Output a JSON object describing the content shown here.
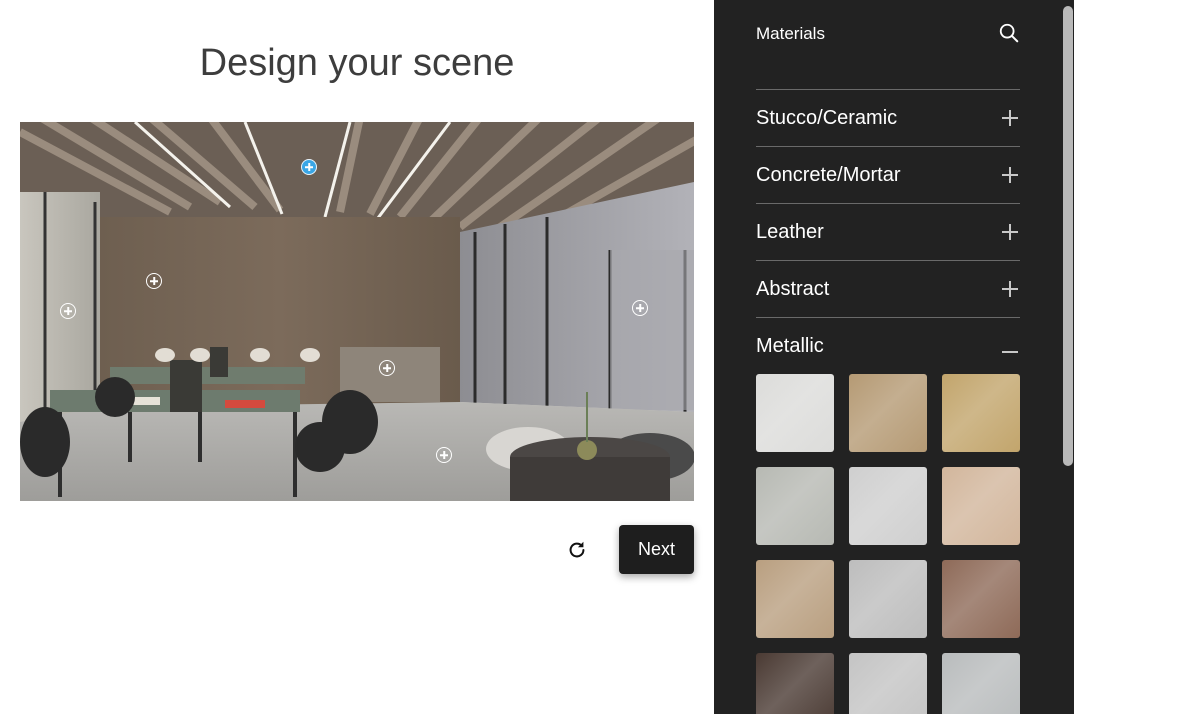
{
  "page": {
    "title": "Design your scene"
  },
  "actions": {
    "next_label": "Next"
  },
  "sidebar": {
    "title": "Materials",
    "categories": [
      {
        "label": "Stucco/Ceramic",
        "expanded": false
      },
      {
        "label": "Concrete/Mortar",
        "expanded": false
      },
      {
        "label": "Leather",
        "expanded": false
      },
      {
        "label": "Abstract",
        "expanded": false
      },
      {
        "label": "Metallic",
        "expanded": true
      }
    ],
    "metallic_swatches": [
      "#dcdcda",
      "#b59a74",
      "#c2a56c",
      "#b7b9b3",
      "#cfcfcf",
      "#d2b69c",
      "#b99f80",
      "#bdbdbd",
      "#8e6a58",
      "#4a3a33",
      "#c4c4c4",
      "#b9bcbd"
    ]
  },
  "colors": {
    "accent": "#3aa6e6",
    "sidebar_bg": "#222222",
    "button_bg": "#1e1e1e"
  }
}
